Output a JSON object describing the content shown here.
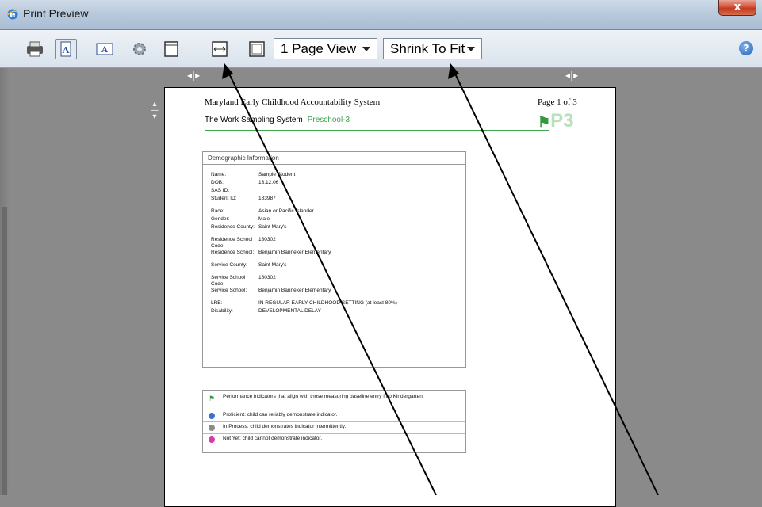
{
  "window": {
    "title": "Print Preview",
    "close_label": "x"
  },
  "toolbar": {
    "page_view_select": "1 Page View",
    "shrink_select": "Shrink To Fit",
    "help_label": "?"
  },
  "document": {
    "system_title": "Maryland Early Childhood Accountability System",
    "page_label": "Page 1 of 3",
    "subtitle": "The Work Sampling System",
    "subtitle_program": "Preschool-3",
    "logo_text": "P3",
    "demographic": {
      "heading": "Demographic Information",
      "rows": [
        {
          "label": "Name:",
          "value": "Sample Student"
        },
        {
          "label": "DOB:",
          "value": "13.12.06"
        },
        {
          "label": "SAS ID:",
          "value": ""
        },
        {
          "label": "Student ID:",
          "value": "183987"
        },
        {
          "label": "Race:",
          "value": "Asian or Pacific Islander"
        },
        {
          "label": "Gender:",
          "value": "Male"
        },
        {
          "label": "Residence County:",
          "value": "Saint Mary's"
        },
        {
          "label": "Residence School Code:",
          "value": "180302"
        },
        {
          "label": "Residence School:",
          "value": "Benjamin Banneker Elementary"
        },
        {
          "label": "Service County:",
          "value": "Saint Mary's"
        },
        {
          "label": "Service School Code:",
          "value": "180302"
        },
        {
          "label": "Service School:",
          "value": "Benjamin Banneker Elementary"
        },
        {
          "label": "LRE:",
          "value": "IN REGULAR EARLY CHILDHOOD SETTING (at least 80%)"
        },
        {
          "label": "Disability:",
          "value": "DEVELOPMENTAL DELAY"
        }
      ]
    },
    "legend": [
      {
        "text": "Performance indicators that align with those measuring baseline entry into Kindergarten.",
        "color": "#2f9a3f"
      },
      {
        "text": "Proficient: child can reliably demonstrate indicator.",
        "color": "#3b6fd1"
      },
      {
        "text": "In Process: child demonstrates indicator intermittently.",
        "color": "#8c8c8c"
      },
      {
        "text": "Not Yet: child cannot demonstrate indicator.",
        "color": "#d23fa6"
      }
    ]
  },
  "colors": {
    "accent_green": "#3aa54a",
    "workspace": "#8a8a8a"
  }
}
